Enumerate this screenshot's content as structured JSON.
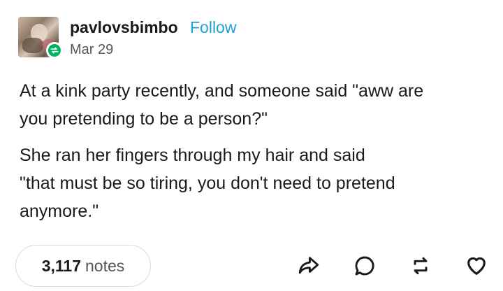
{
  "post": {
    "author": {
      "username": "pavlovsbimbo",
      "follow_label": "Follow",
      "date": "Mar 29",
      "avatar_icon": "avatar-image",
      "badge_icon": "reblog-icon"
    },
    "paragraphs": [
      "At a kink party recently, and someone said \"aww are\nyou pretending to be a person?\"",
      "She ran her fingers through my hair and said\n\"that must be so tiring, you don't need to pretend\nanymore.\""
    ],
    "notes": {
      "count": "3,117",
      "label": "notes"
    },
    "actions": [
      "share-icon",
      "reply-icon",
      "reblog-icon",
      "like-icon"
    ],
    "colors": {
      "follow": "#1da1d6",
      "reblog_badge": "#00b35f",
      "icon_stroke": "#1a1a1a"
    }
  }
}
